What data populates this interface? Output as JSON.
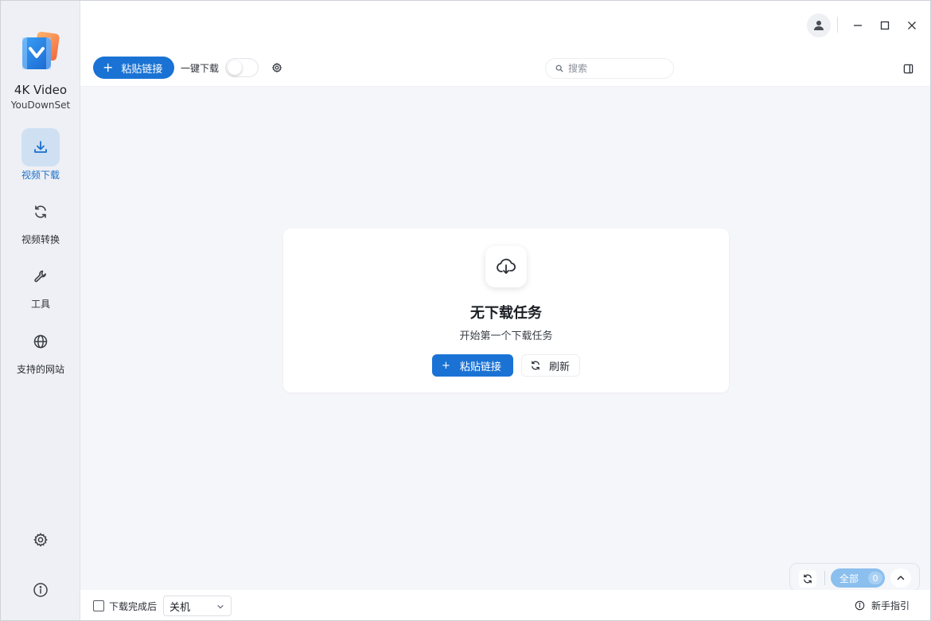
{
  "app": {
    "name": "4K Video",
    "subtitle": "YouDownSet"
  },
  "sidebar": {
    "items": [
      {
        "label": "视频下载",
        "icon": "download-icon",
        "active": true
      },
      {
        "label": "视频转换",
        "icon": "refresh-icon",
        "active": false
      },
      {
        "label": "工具",
        "icon": "wrench-icon",
        "active": false
      },
      {
        "label": "支持的网站",
        "icon": "globe-icon",
        "active": false
      }
    ],
    "bottom_icons": [
      "settings-gear-icon",
      "info-icon"
    ]
  },
  "titlebar": {
    "icons": [
      "user-icon",
      "minimize-icon",
      "maximize-icon",
      "close-icon"
    ]
  },
  "toolbar": {
    "paste_label": "粘贴链接",
    "onekey_label": "一键下载",
    "onekey_enabled": false,
    "search_placeholder": "搜索"
  },
  "empty_state": {
    "title": "无下载任务",
    "subtitle": "开始第一个下载任务",
    "paste_label": "粘贴链接",
    "refresh_label": "刷新"
  },
  "filter": {
    "all_label": "全部",
    "count": "0"
  },
  "bottombar": {
    "after_download_label": "下载完成后",
    "after_download_checked": false,
    "action_value": "关机",
    "guide_label": "新手指引"
  },
  "colors": {
    "accent": "#1a73d4",
    "sidebar_bg": "#eef0f5",
    "content_bg": "#f5f6fa",
    "active_nav_bg": "#cfe0f3"
  }
}
